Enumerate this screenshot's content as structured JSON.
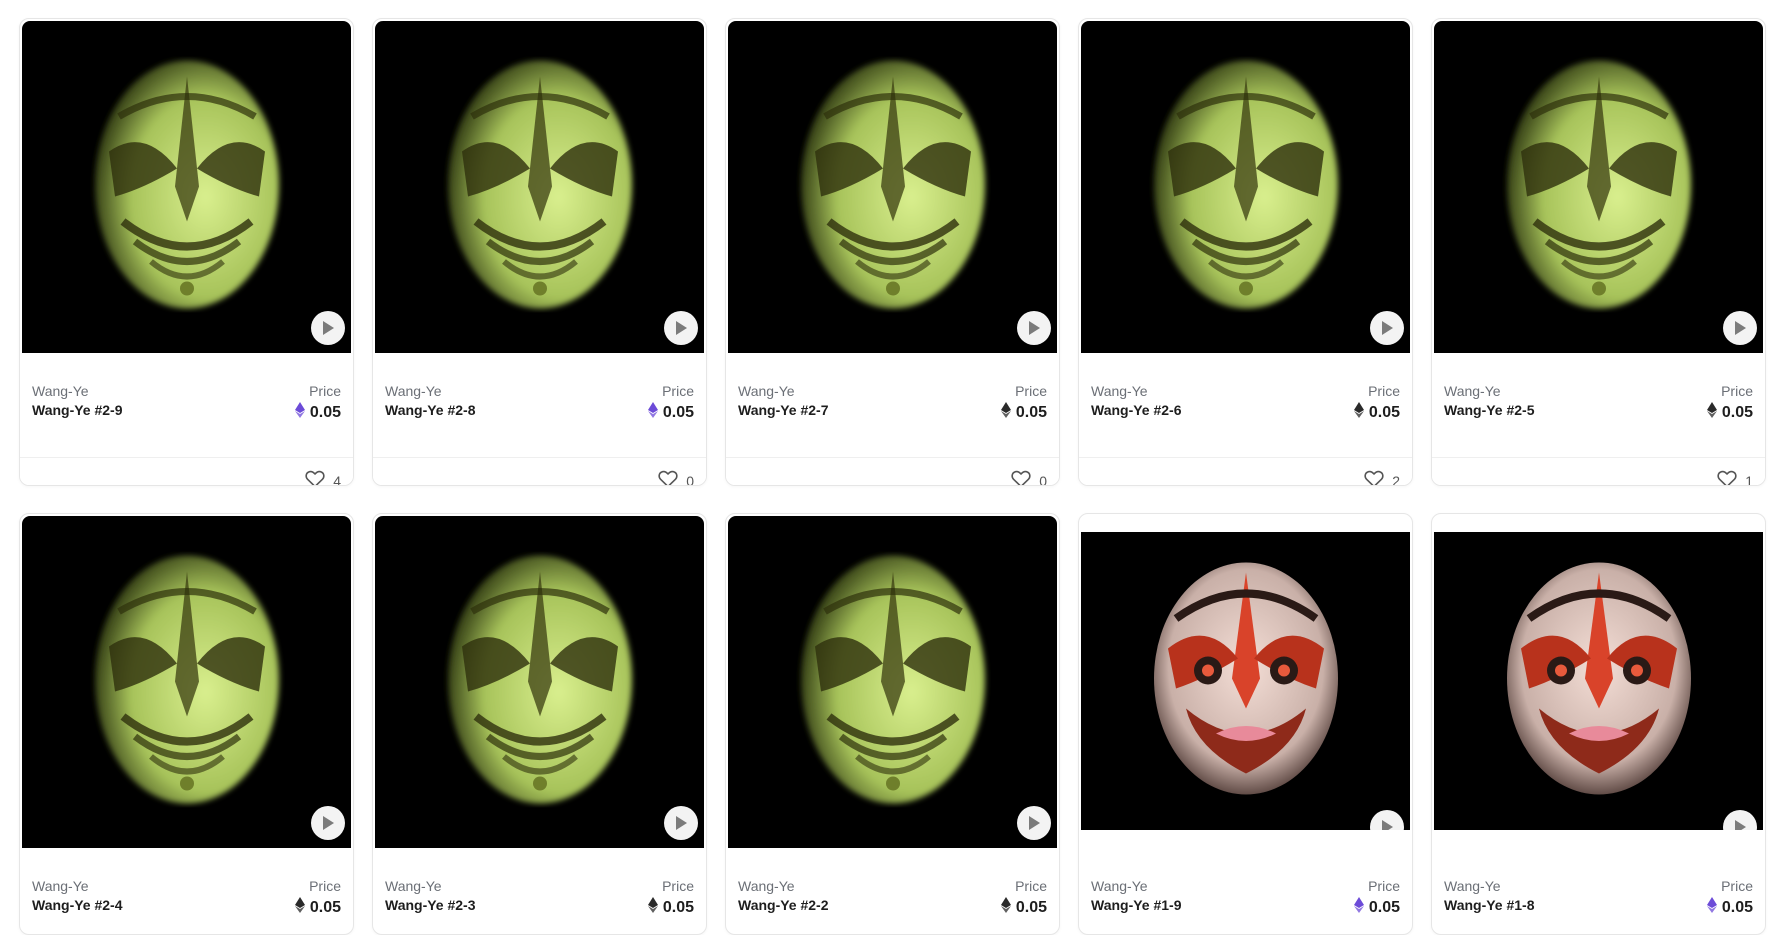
{
  "cards": [
    {
      "collection": "Wang-Ye",
      "name": "Wang-Ye #2-9",
      "price_label": "Price",
      "price": "0.05",
      "eth_icon": "eth-purple",
      "likes": "4",
      "mask": "green",
      "media": "full"
    },
    {
      "collection": "Wang-Ye",
      "name": "Wang-Ye #2-8",
      "price_label": "Price",
      "price": "0.05",
      "eth_icon": "eth-purple",
      "likes": "0",
      "mask": "green",
      "media": "full"
    },
    {
      "collection": "Wang-Ye",
      "name": "Wang-Ye #2-7",
      "price_label": "Price",
      "price": "0.05",
      "eth_icon": "eth-black",
      "likes": "0",
      "mask": "green",
      "media": "full"
    },
    {
      "collection": "Wang-Ye",
      "name": "Wang-Ye #2-6",
      "price_label": "Price",
      "price": "0.05",
      "eth_icon": "eth-black",
      "likes": "2",
      "mask": "green",
      "media": "full"
    },
    {
      "collection": "Wang-Ye",
      "name": "Wang-Ye #2-5",
      "price_label": "Price",
      "price": "0.05",
      "eth_icon": "eth-black",
      "likes": "1",
      "mask": "green",
      "media": "full"
    },
    {
      "collection": "Wang-Ye",
      "name": "Wang-Ye #2-4",
      "price_label": "Price",
      "price": "0.05",
      "eth_icon": "eth-black",
      "likes": "",
      "mask": "green",
      "media": "full"
    },
    {
      "collection": "Wang-Ye",
      "name": "Wang-Ye #2-3",
      "price_label": "Price",
      "price": "0.05",
      "eth_icon": "eth-black",
      "likes": "",
      "mask": "green",
      "media": "full"
    },
    {
      "collection": "Wang-Ye",
      "name": "Wang-Ye #2-2",
      "price_label": "Price",
      "price": "0.05",
      "eth_icon": "eth-black",
      "likes": "",
      "mask": "green",
      "media": "full"
    },
    {
      "collection": "Wang-Ye",
      "name": "Wang-Ye #1-9",
      "price_label": "Price",
      "price": "0.05",
      "eth_icon": "eth-purple",
      "likes": "",
      "mask": "red",
      "media": "short"
    },
    {
      "collection": "Wang-Ye",
      "name": "Wang-Ye #1-8",
      "price_label": "Price",
      "price": "0.05",
      "eth_icon": "eth-purple",
      "likes": "",
      "mask": "red",
      "media": "short"
    }
  ],
  "colors": {
    "eth_purple": "#6c4bd8",
    "eth_black": "#2a2a2a",
    "mask_green": "#c7e07a",
    "mask_red": "#d9432a"
  }
}
